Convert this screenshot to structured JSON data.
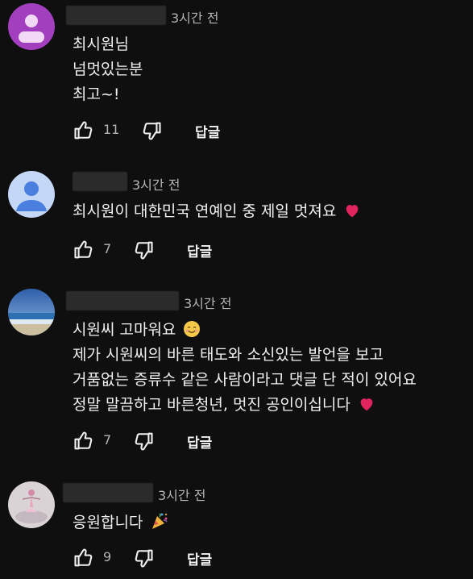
{
  "comments": [
    {
      "avatar": "default-purple-avatar",
      "time": "3시간 전",
      "lines": [
        "최시원님",
        "넘멋있는분",
        "최고~!"
      ],
      "likes": "11",
      "reply_label": "답글"
    },
    {
      "avatar": "default-blue-avatar",
      "time": "3시간 전",
      "lines": [
        "최시원이 대한민국 연예인 중 제일 멋져요"
      ],
      "likes": "7",
      "reply_label": "답글"
    },
    {
      "avatar": "beach-photo-avatar",
      "time": "3시간 전",
      "lines": [
        "시원씨 고마워요",
        "제가 시원씨의 바른 태도와 소신있는 발언을 보고",
        "거품없는 증류수 같은 사람이라고 댓글 단 적이 있어요",
        "정말 말끔하고 바른청년, 멋진 공인이십니다"
      ],
      "likes": "7",
      "reply_label": "답글"
    },
    {
      "avatar": "ballerina-photo-avatar",
      "time": "3시간 전",
      "lines": [
        "응원합니다"
      ],
      "likes": "9",
      "reply_label": "답글"
    }
  ],
  "icons": {
    "like": "thumbs-up-icon",
    "dislike": "thumbs-down-icon",
    "heart": "red-heart-emoji",
    "smile": "smiling-face-emoji",
    "party": "party-popper-emoji"
  },
  "colors": {
    "background": "#0f0f0f",
    "text": "#f1f1f1",
    "muted": "#b5b5b5",
    "heart": "#e0245e"
  }
}
